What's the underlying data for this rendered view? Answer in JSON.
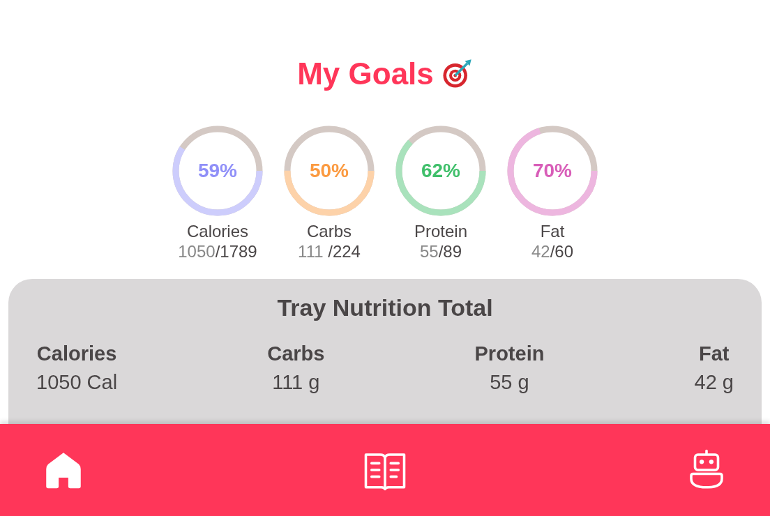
{
  "title": "My Goals",
  "goals": [
    {
      "name": "Calories",
      "percent": "59%",
      "level": 0.59,
      "consumed": "1050",
      "target": "/1789",
      "color": "#8f8ff8"
    },
    {
      "name": "Carbs",
      "percent": "50%",
      "level": 0.5,
      "consumed": "111 ",
      "target": "/224",
      "color": "#fb9a40"
    },
    {
      "name": "Protein",
      "percent": "62%",
      "level": 0.62,
      "consumed": "55",
      "target": "/89",
      "color": "#3fbf6a"
    },
    {
      "name": "Fat",
      "percent": "70%",
      "level": 0.7,
      "consumed": "42",
      "target": "/60",
      "color": "#d85db8"
    }
  ],
  "tray": {
    "title": "Tray Nutrition Total",
    "items": [
      {
        "label": "Calories",
        "value": "1050 Cal"
      },
      {
        "label": "Carbs",
        "value": "111 g"
      },
      {
        "label": "Protein",
        "value": "55 g"
      },
      {
        "label": "Fat",
        "value": "42 g"
      }
    ]
  },
  "nav": [
    {
      "kind": "home"
    },
    {
      "kind": "book"
    },
    {
      "kind": "robot"
    }
  ]
}
